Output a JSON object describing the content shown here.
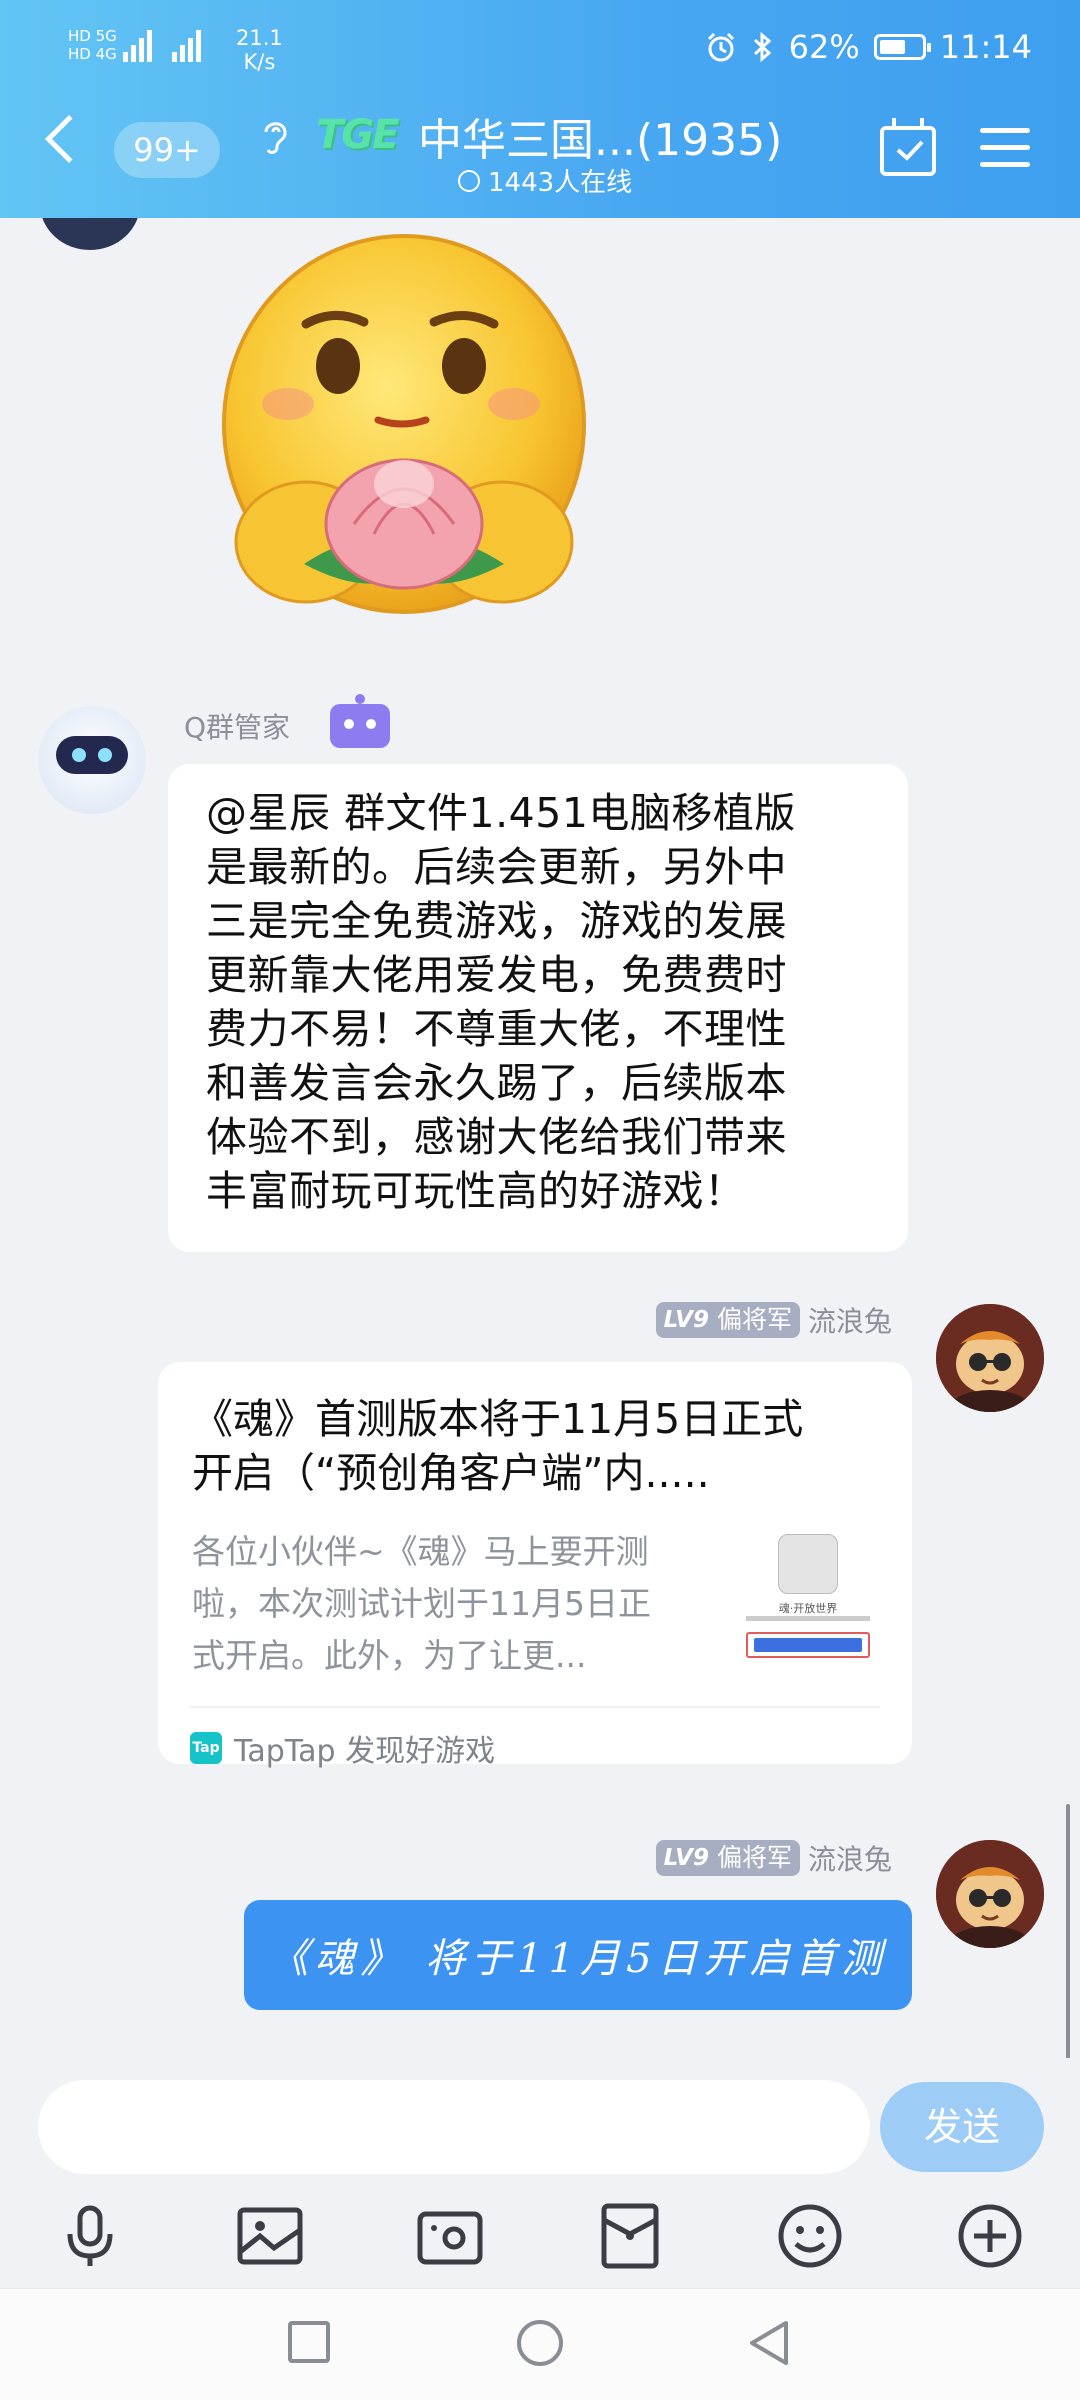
{
  "status_bar": {
    "network_left": "HD 5G",
    "network_right": "HD 4G",
    "speed_value": "21.1",
    "speed_unit": "K/s",
    "battery": "62%",
    "battery_level": 0.62,
    "time": "11:14",
    "icons": [
      "alarm-icon",
      "bluetooth-icon",
      "battery-icon"
    ]
  },
  "header": {
    "back_icon": "chevron-left-icon",
    "unread_badge": "99+",
    "group_logo_text": "TGE",
    "title": "中华三国...(1935)",
    "online_count": "1443人在线",
    "right_icons": [
      "calendar-check-icon",
      "menu-icon"
    ]
  },
  "messages": [
    {
      "type": "sticker",
      "sticker": "praying-smiley-with-peach-icon"
    },
    {
      "type": "text",
      "sender": "Q群管家",
      "sender_badge": "robot-icon",
      "lines": [
        "@星辰 群文件1.451电脑移植版",
        "是最新的。后续会更新，另外中",
        "三是完全免费游戏，游戏的发展",
        "更新靠大佬用爱发电，免费费时",
        "费力不易！不尊重大佬，不理性",
        "和善发言会永久踢了，后续版本",
        "体验不到，感谢大佬给我们带来",
        "丰富耐玩可玩性高的好游戏！"
      ]
    },
    {
      "type": "card",
      "level": "LV9",
      "rank": "偏将军",
      "sender": "流浪兔",
      "title_lines": [
        "《魂》首测版本将于11月5日正式",
        "开启（“预创角客户端”内....."
      ],
      "desc_lines": [
        "各位小伙伴~《魂》马上要开测",
        "啦，本次测试计划于11月5日正",
        "式开启。此外，为了让更..."
      ],
      "source": "TapTap 发现好游戏",
      "thumb_caption": "魂·开放世界"
    },
    {
      "type": "highlight",
      "level": "LV9",
      "rank": "偏将军",
      "sender": "流浪兔",
      "text": "《魂》 将于11月5日开启首测"
    }
  ],
  "composer": {
    "placeholder": "",
    "send_label": "发送",
    "tools": [
      "microphone-icon",
      "image-icon",
      "camera-icon",
      "red-packet-icon",
      "emoji-icon",
      "plus-icon"
    ]
  },
  "nav": [
    "recent-apps-icon",
    "home-icon",
    "back-icon"
  ]
}
